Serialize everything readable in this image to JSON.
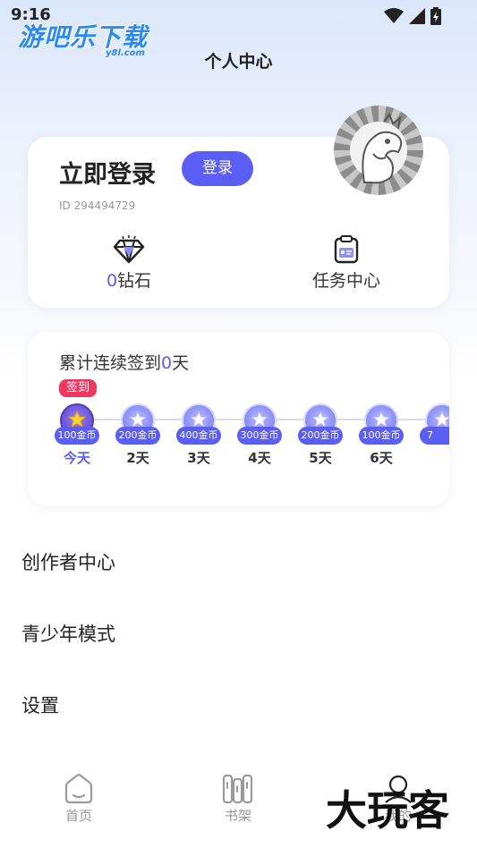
{
  "status_bar": {
    "time": "9:16"
  },
  "watermark": {
    "text": "游吧乐下载",
    "sub": "y8l.com"
  },
  "header": {
    "title": "个人中心"
  },
  "profile": {
    "login_title": "立即登录",
    "login_button": "登录",
    "user_id": "ID 294494729",
    "diamond_count": "0",
    "diamond_label": "钻石",
    "task_label": "任务中心"
  },
  "checkin": {
    "title_prefix": "累计连续签到",
    "days_count": "0",
    "title_suffix": "天",
    "tag": "签到",
    "days": [
      {
        "reward": "100金币",
        "label": "今天"
      },
      {
        "reward": "200金币",
        "label": "2天"
      },
      {
        "reward": "400金币",
        "label": "3天"
      },
      {
        "reward": "300金币",
        "label": "4天"
      },
      {
        "reward": "200金币",
        "label": "5天"
      },
      {
        "reward": "100金币",
        "label": "6天"
      },
      {
        "reward": "7",
        "label": ""
      }
    ]
  },
  "menu": {
    "creator_center": "创作者中心",
    "youth_mode": "青少年模式",
    "settings": "设置"
  },
  "tabbar": {
    "home": "首页",
    "bookshelf": "书架",
    "mine": "我的"
  },
  "corner_mark": "大玩客",
  "colors": {
    "accent": "#5b5ef5",
    "tag": "#f0375f"
  }
}
